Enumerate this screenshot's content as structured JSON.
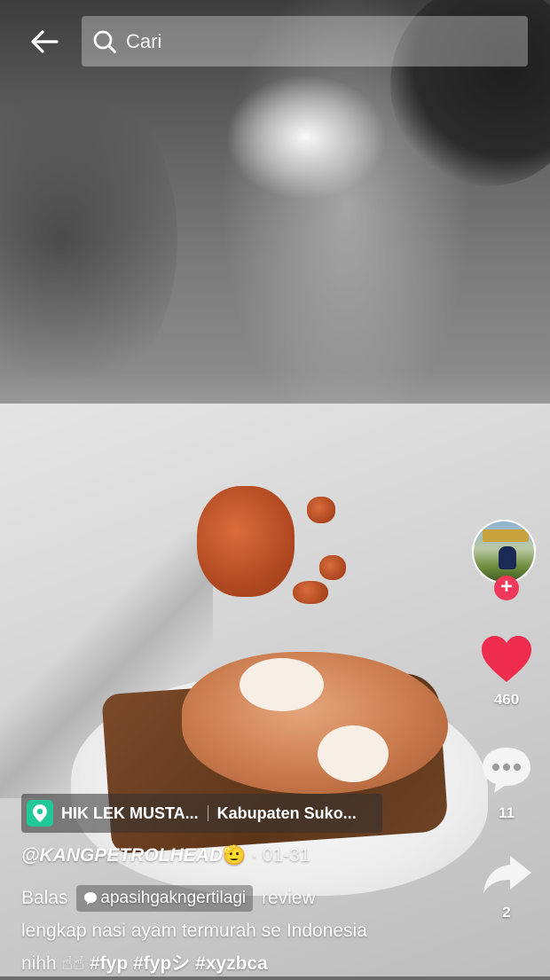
{
  "search": {
    "placeholder": "Cari"
  },
  "location": {
    "name": "HIK LEK MUSTA...",
    "region": "Kabupaten Suko..."
  },
  "post": {
    "author": "@KANGPETROLHEAD",
    "author_emoji": "🫡",
    "separator": " · ",
    "date": "01-31",
    "reply_prefix": "Balas",
    "reply_user": "apasihgakngertilagi",
    "caption_line1_tail": "review",
    "caption_line2": "lengkap nasi ayam termurah se Indonesia",
    "caption_line3_start": "nihh ☝☝",
    "hashtags": [
      "#fyp",
      "#fypシ",
      "#xyzbca"
    ]
  },
  "actions": {
    "likes": "460",
    "comments": "11",
    "shares": "2"
  },
  "colors": {
    "like": "#ee2c4e",
    "follow": "#f0385b",
    "location_pin": "#20c997"
  },
  "icons": [
    "back-arrow-icon",
    "search-icon",
    "heart-icon",
    "comment-icon",
    "share-icon",
    "location-pin-icon",
    "plus-icon"
  ]
}
